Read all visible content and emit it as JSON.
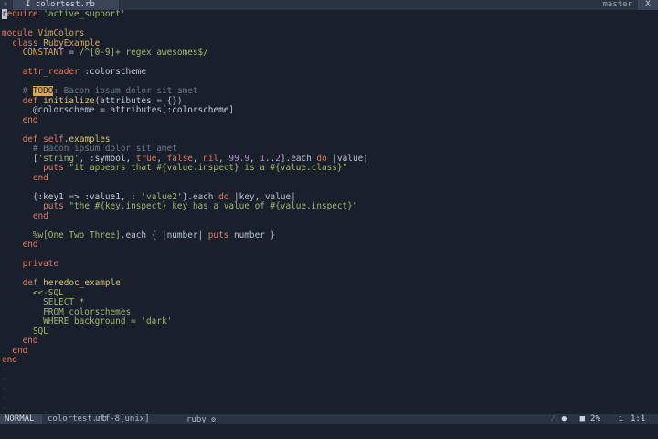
{
  "tabline": {
    "tab_label": "I colortest.rb",
    "branch": "master",
    "close": "X"
  },
  "editor": {
    "lines": [
      "require 'active_support'",
      "",
      "module VimColors",
      "  class RubyExample",
      "    CONSTANT = /^[0-9]+ regex awesomes$/",
      "",
      "    attr_reader :colorscheme",
      "",
      "    # TODO: Bacon ipsum dolor sit amet",
      "    def initialize(attributes = {})",
      "      @colorscheme = attributes[:colorscheme]",
      "    end",
      "",
      "    def self.examples",
      "      # Bacon ipsum dolor sit amet",
      "      ['string', :symbol, true, false, nil, 99.9, 1..2].each do |value|",
      "        puts \"it appears that #{value.inspect} is a #{value.class}\"",
      "      end",
      "",
      "      {:key1 => :value1, key2: 'value2'}.each do |key, value|",
      "        puts \"the #{key.inspect} key has a value of #{value.inspect}\"",
      "      end",
      "",
      "      %w[One Two Three].each { |number| puts number }",
      "    end",
      "",
      "    private",
      "",
      "    def heredoc_example",
      "      <<-SQL",
      "        SELECT *",
      "        FROM colorschemes",
      "        WHERE background = 'dark'",
      "      SQL",
      "    end",
      "  end",
      "end"
    ],
    "tilde": "~"
  },
  "statusline": {
    "mode": "NORMAL",
    "filename": "colortest.rb",
    "encoding": "utf-8[unix]",
    "filetype": "ruby",
    "percent": "2%",
    "position": "1:1"
  },
  "colors": {
    "background": "#19202b",
    "keyword": "#e07b5f",
    "string": "#9fb86c",
    "comment": "#6b7889",
    "constant": "#d6a85a",
    "number": "#c38ad8"
  }
}
